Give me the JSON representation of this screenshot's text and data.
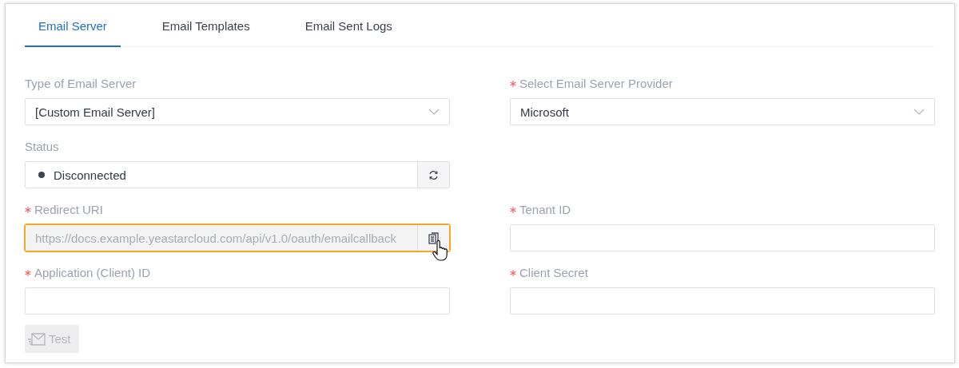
{
  "tabs": [
    {
      "label": "Email Server",
      "selected": true
    },
    {
      "label": "Email Templates",
      "selected": false
    },
    {
      "label": "Email Sent Logs",
      "selected": false
    }
  ],
  "form_rows": [
    {
      "left": {
        "kind": "select",
        "label": "Type of Email Server",
        "required": false,
        "value": "[Custom Email Server]"
      },
      "right": {
        "kind": "select",
        "label": "Select Email Server Provider",
        "required": true,
        "value": "Microsoft"
      }
    },
    {
      "left": {
        "kind": "status",
        "label": "Status",
        "required": false,
        "value": "Disconnected",
        "connected": false
      }
    },
    {
      "left": {
        "kind": "copy",
        "label": "Redirect URI",
        "required": true,
        "value": "https://docs.example.yeastarcloud.com/api/v1.0/oauth/emailcallback",
        "highlighted": true
      },
      "right": {
        "kind": "text",
        "label": "Tenant ID",
        "required": true
      }
    },
    {
      "left": {
        "kind": "text",
        "label": "Application (Client) ID",
        "required": true
      },
      "right": {
        "kind": "text",
        "label": "Client Secret",
        "required": true
      }
    }
  ],
  "test_button": {
    "label": "Test",
    "disabled": true
  }
}
